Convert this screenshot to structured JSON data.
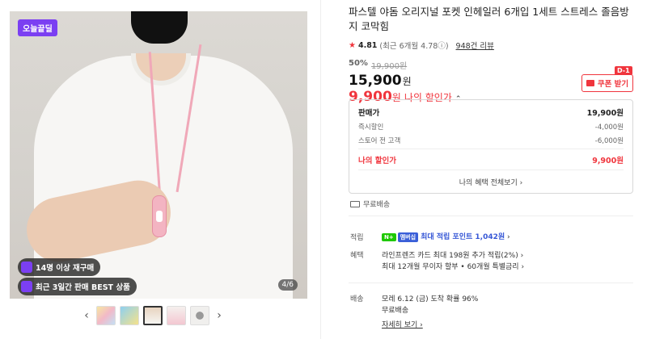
{
  "gallery": {
    "badge_today": "오늘끝딜",
    "repurchase_badge": "14명 이상 재구매",
    "best_badge": "최근 3일간 판매 BEST 상품",
    "counter": "4/6",
    "thumb_prev": "‹",
    "thumb_next": "›"
  },
  "product": {
    "title": "파스텔 야돔 오리지널 포켓 인헤일러 6개입 1세트 스트레스 졸음방지 코막힘",
    "rating": "4.81",
    "rating_sub": "(최근 6개월 4.78ⓘ)",
    "reviews": "948건 리뷰",
    "discount_rate": "50%",
    "original_price": "19,900원",
    "price": "15,900",
    "price_unit": "원",
    "my_price": "9,900",
    "my_price_unit": "원",
    "my_label": "나의 할인가",
    "coupon_label": "쿠폰 받기",
    "dday": "D-1"
  },
  "breakdown": {
    "sale_label": "판매가",
    "sale_value": "19,900원",
    "instant_label": "즉시할인",
    "instant_value": "-4,000원",
    "store_label": "스토어 전 고객",
    "store_value": "-6,000원",
    "my_label": "나의 할인가",
    "my_value": "9,900원",
    "view_all": "나의 혜택 전체보기 ›"
  },
  "shipping_free": "무료배송",
  "points": {
    "label": "적립",
    "badge1": "N+",
    "badge2": "멤버십",
    "text": "최대 적립 포인트 1,042원",
    "chevron": "›"
  },
  "benefits": {
    "label": "혜택",
    "line1": "라인프렌즈 카드 최대 198원 추가 적립(2%) ›",
    "line2": "최대 12개월 무이자 할부 • 60개월 특별금리 ›"
  },
  "delivery": {
    "label": "배송",
    "line1": "모레 6.12 (금) 도착 확률 96%",
    "line2": "무료배송",
    "detail": "자세히 보기 ›"
  },
  "colors": {
    "accent": "#f0353d",
    "purple": "#7b3ff2",
    "blue": "#3657d6",
    "naver_green": "#1ec800"
  }
}
